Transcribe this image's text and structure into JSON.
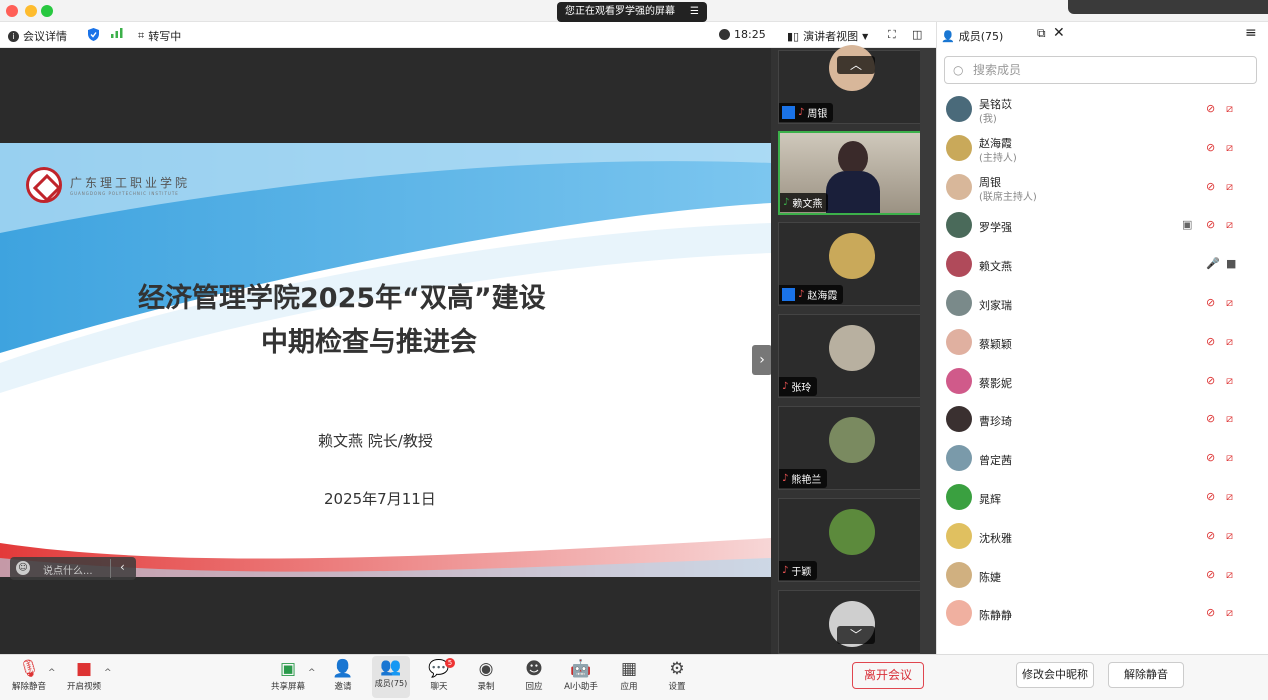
{
  "window": {
    "banner": "您正在观看罗学强的屏幕",
    "banner_menu": "☰"
  },
  "toolbar": {
    "meeting_info": "会议详情",
    "transcribing": "转写中",
    "time": "18:25",
    "view": "演讲者视图"
  },
  "slide": {
    "title_line1": "经济管理学院2025年“双高”建设",
    "title_line2": "中期检查与推进会",
    "presenter": "赖文燕 院长/教授",
    "date": "2025年7月11日",
    "logo_text": "广东理工职业学院",
    "logo_subtext": "GUANGDONG POLYTECHNIC INSTITUTE",
    "chat_placeholder": "说点什么..."
  },
  "video_tiles": [
    {
      "name": "周银",
      "host_badge": true,
      "avatar_color": "#d8b79a"
    },
    {
      "name": "赖文燕",
      "active": true,
      "avatar_color": "#6b5a4a"
    },
    {
      "name": "赵海霞",
      "host_badge": true,
      "avatar_color": "#c9a95a"
    },
    {
      "name": "张玲",
      "avatar_color": "#b8b0a0"
    },
    {
      "name": "熊艳兰",
      "avatar_color": "#7a8a60"
    },
    {
      "name": "于颖",
      "avatar_color": "#5c8a3c"
    },
    {
      "name": "",
      "avatar_color": "#cfcfcf"
    }
  ],
  "panel": {
    "title": "成员(75)",
    "search_placeholder": "搜索成员"
  },
  "members": [
    {
      "name": "吴铭苡",
      "role": "(我)",
      "color": "#4a6a7a"
    },
    {
      "name": "赵海霞",
      "role": "(主持人)",
      "color": "#c9a95a"
    },
    {
      "name": "周银",
      "role": "(联席主持人)",
      "color": "#d8b79a"
    },
    {
      "name": "罗学强",
      "role": "",
      "color": "#4a6a5a",
      "sharing": true
    },
    {
      "name": "赖文燕",
      "role": "",
      "color": "#b04a5a",
      "unmuted": true
    },
    {
      "name": "刘家瑞",
      "role": "",
      "color": "#7a8a8a"
    },
    {
      "name": "蔡颖颖",
      "role": "",
      "color": "#e0b0a0"
    },
    {
      "name": "蔡影妮",
      "role": "",
      "color": "#d05a8a"
    },
    {
      "name": "曹珍琦",
      "role": "",
      "color": "#3a3030"
    },
    {
      "name": "曾定茜",
      "role": "",
      "color": "#7a9aaa"
    },
    {
      "name": "晁辉",
      "role": "",
      "color": "#3aa040"
    },
    {
      "name": "沈秋雅",
      "role": "",
      "color": "#e0c060"
    },
    {
      "name": "陈婕",
      "role": "",
      "color": "#d0b080"
    },
    {
      "name": "陈静静",
      "role": "",
      "color": "#f0b0a0"
    }
  ],
  "bottom": {
    "unmute": "解除静音",
    "video": "开启视频",
    "share": "共享屏幕",
    "invite": "邀请",
    "members": "成员(75)",
    "chat": "聊天",
    "chat_badge": "5",
    "record": "录制",
    "react": "回应",
    "ai": "AI小助手",
    "apps": "应用",
    "settings": "设置",
    "leave": "离开会议",
    "rename": "修改会中昵称",
    "panel_unmute": "解除静音"
  },
  "colors": {
    "accent": "#1a73e8",
    "danger": "#d8303a",
    "active_tile": "#3cb04a"
  }
}
